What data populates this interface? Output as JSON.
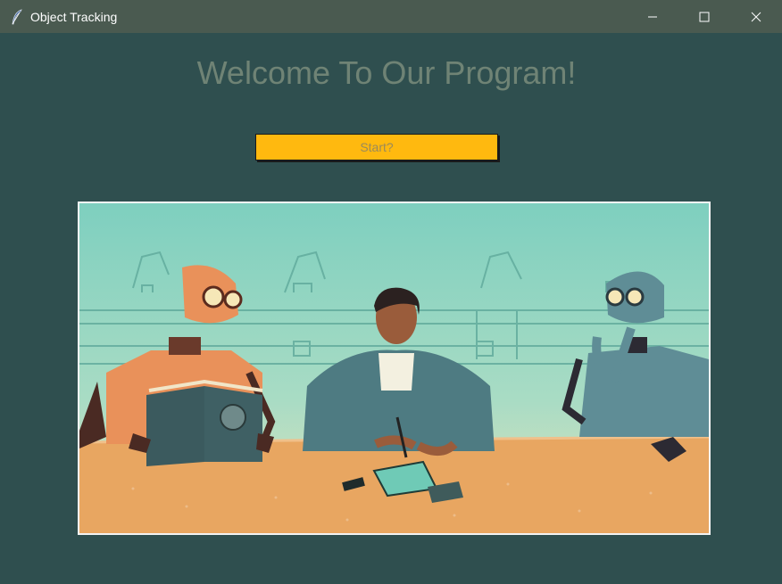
{
  "window": {
    "title": "Object Tracking",
    "icon": "feather-icon",
    "controls": [
      "minimize-icon",
      "maximize-icon",
      "close-icon"
    ]
  },
  "main": {
    "heading": "Welcome To Our Program!",
    "start_button_label": "Start?"
  },
  "illustration": {
    "subject": "robots-and-engineer-illustration"
  },
  "colors": {
    "background": "#2f4f4f",
    "titlebar": "#4a5a50",
    "heading": "#6f8375",
    "button": "#ffb90f"
  }
}
